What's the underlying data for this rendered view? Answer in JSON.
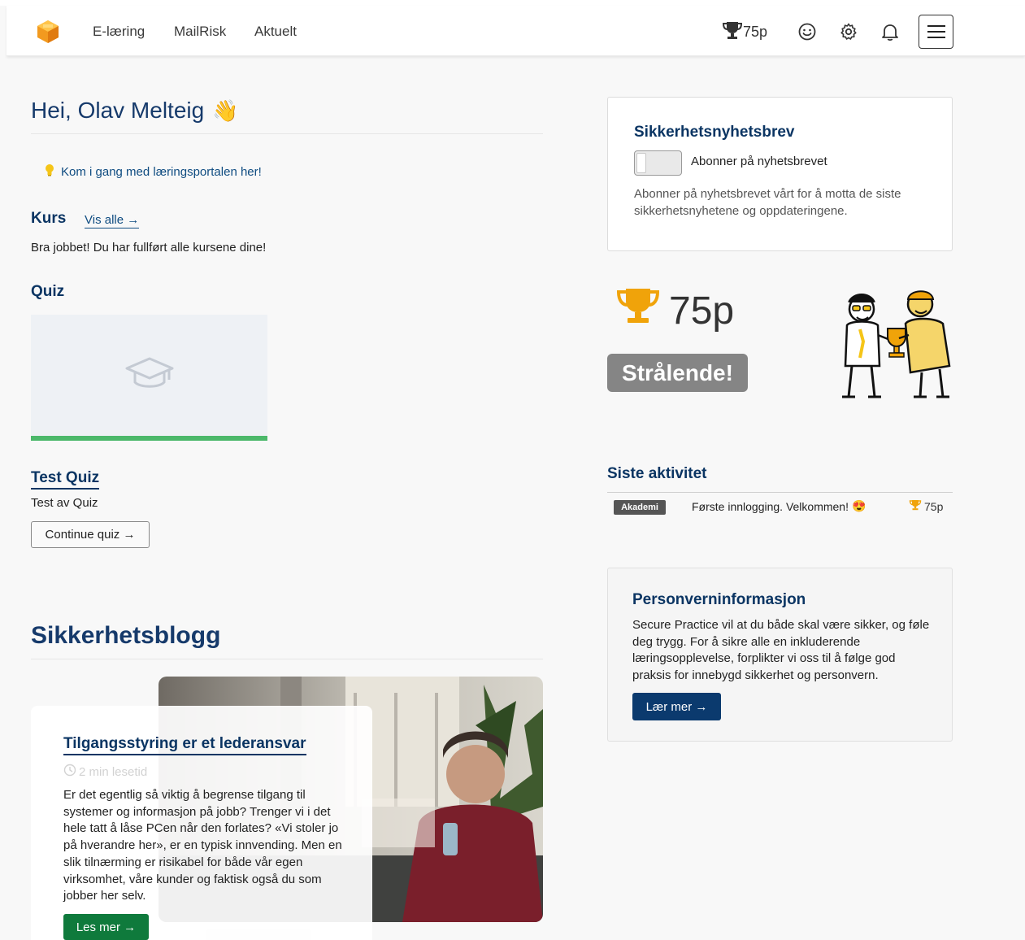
{
  "nav": {
    "links": [
      "E-læring",
      "MailRisk",
      "Aktuelt"
    ],
    "points": "75p"
  },
  "greeting": {
    "text": "Hei, Olav Melteig",
    "emoji": "👋"
  },
  "getting_started": "Kom i gang med læringsportalen her!",
  "courses": {
    "heading": "Kurs",
    "see_all": "Vis alle →",
    "message": "Bra jobbet! Du har fullført alle kursene dine!"
  },
  "quiz": {
    "heading": "Quiz",
    "progress": 1.0,
    "title": "Test Quiz",
    "description": "Test av Quiz",
    "button": "Continue quiz →"
  },
  "blog": {
    "heading": "Sikkerhetsblogg",
    "post_title": "Tilgangsstyring er et lederansvar",
    "read_time": "2 min lesetid",
    "excerpt": "Er det egentlig så viktig å begrense tilgang til systemer og informasjon på jobb? Trenger vi i det hele tatt å låse PCen når den forlates? «Vi stoler jo på hverandre her», er en typisk innvending. Men en slik tilnærming er risikabel for både vår egen virksomhet, våre kunder og faktisk også du som jobber her selv.",
    "button": "Les mer →"
  },
  "newsletter": {
    "heading": "Sikkerhetsnyhetsbrev",
    "toggle_label": "Abonner på nyhetsbrevet",
    "subscribed": false,
    "description": "Abonner på nyhetsbrevet vårt for å motta de siste sikkerhetsnyhetene og oppdateringene."
  },
  "score": {
    "points": "75p",
    "badge": "Strålende!"
  },
  "activity": {
    "heading": "Siste aktivitet",
    "items": [
      {
        "tag": "Akademi",
        "text": "Første innlogging. Velkommen!",
        "emoji": "😍",
        "points": "75p"
      }
    ]
  },
  "privacy": {
    "heading": "Personverninformasjon",
    "text": "Secure Practice vil at du både skal være sikker, og føle deg trygg. For å sikre alle en inkluderende læringsopplevelse, forplikter vi oss til å følge god praksis for innebygd sikkerhet og personvern.",
    "button": "Lær mer →"
  },
  "colors": {
    "primary": "#0b3563",
    "accent_green": "#0f7a3c",
    "trophy": "#f0a30a",
    "quiz_progress": "#4bb86a"
  },
  "icons": [
    "logo-icon",
    "trophy-icon",
    "smiley-icon",
    "gear-icon",
    "bell-icon",
    "menu-icon",
    "lightbulb-icon",
    "graduation-cap-icon",
    "clock-icon"
  ]
}
